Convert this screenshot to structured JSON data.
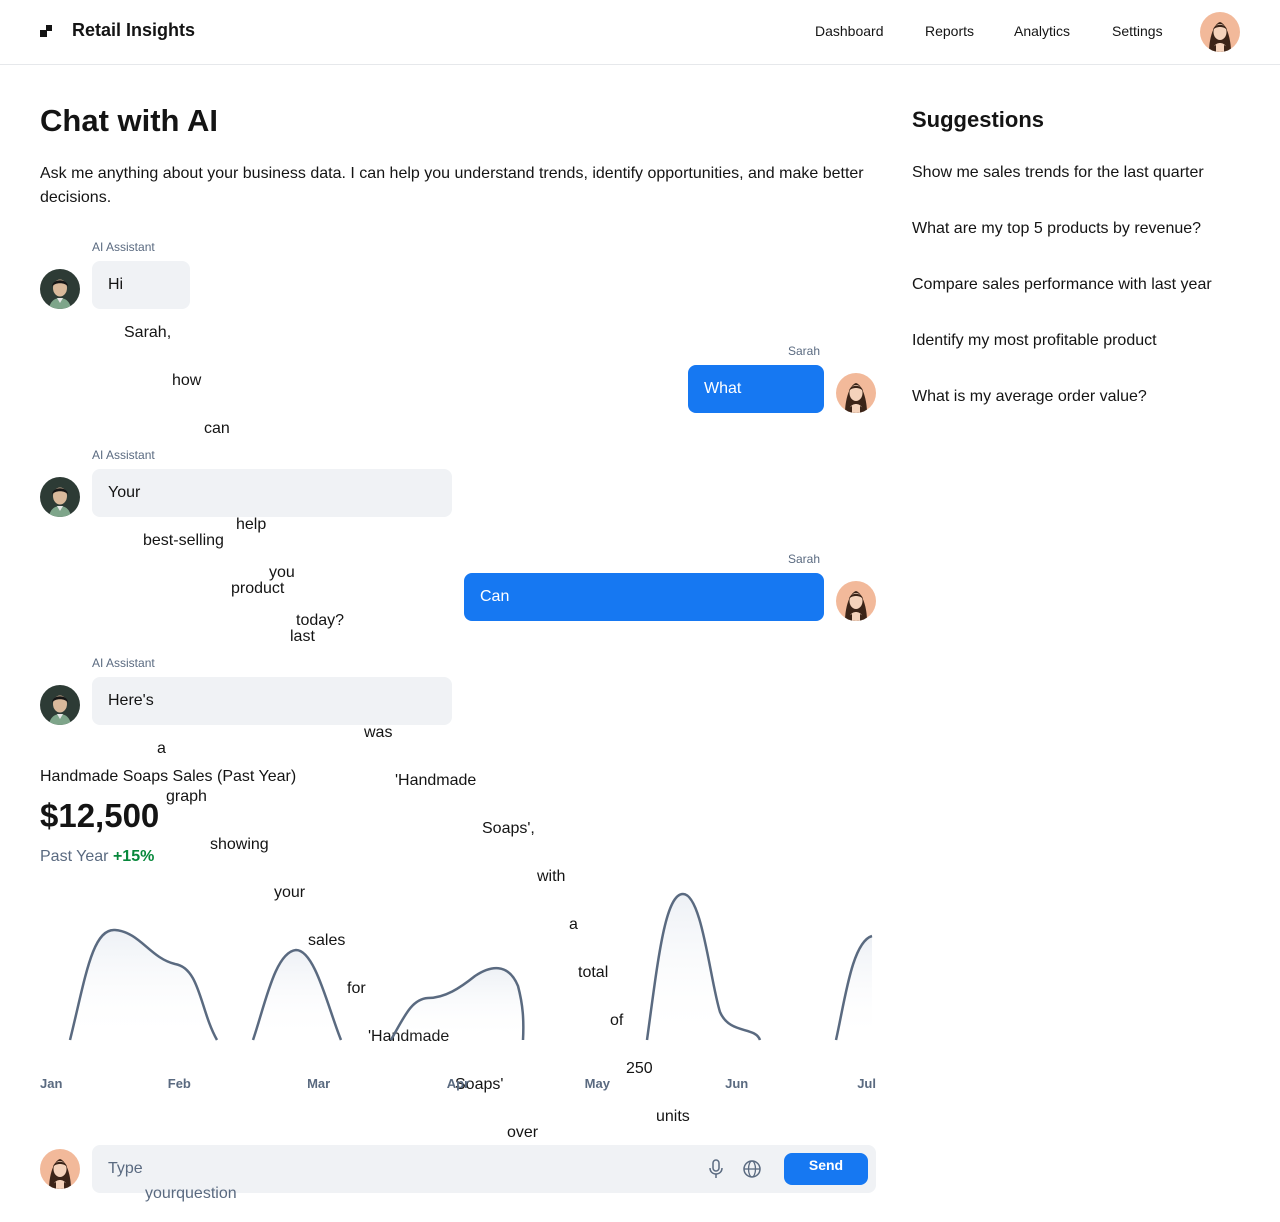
{
  "header": {
    "brand": "Retail Insights",
    "nav": [
      "Dashboard",
      "Reports",
      "Analytics",
      "Settings"
    ]
  },
  "main": {
    "title": "Chat with AI",
    "description": "Ask me anything about your business data. I can help you understand trends, identify opportunities, and make better decisions."
  },
  "messages": [
    {
      "role": "ai",
      "sender": "AI Assistant",
      "text": "Hi"
    },
    {
      "role": "user",
      "sender": "Sarah",
      "text": "What"
    },
    {
      "role": "ai",
      "sender": "AI Assistant",
      "text": "Your"
    },
    {
      "role": "user",
      "sender": "Sarah",
      "text": "Can"
    },
    {
      "role": "ai",
      "sender": "AI Assistant",
      "text": "Here's"
    }
  ],
  "overflow_words": {
    "greeting": [
      "Sarah,",
      "how",
      "can",
      "help",
      "you",
      "today?"
    ],
    "question": [
      "best-selling",
      "product",
      "last",
      "was",
      "'Handmade",
      "Soaps',",
      "with",
      "a",
      "total",
      "of",
      "250",
      "units",
      "over"
    ],
    "answer": [
      "a",
      "graph",
      "showing",
      "your",
      "sales",
      "for",
      "'Handmade",
      "Soaps'"
    ],
    "input": [
      "yourquestion"
    ]
  },
  "chart_data": {
    "type": "area",
    "title": "Handmade Soaps Sales (Past Year)",
    "value": "$12,500",
    "period": "Past Year",
    "change": "+15%",
    "categories": [
      "Jan",
      "Feb",
      "Mar",
      "Apr",
      "May",
      "Jun",
      "Jul"
    ],
    "line_color": "#5a6a80"
  },
  "suggestions": {
    "title": "Suggestions",
    "items": [
      "Show me sales trends for the last quarter",
      "What are my top 5 products by revenue?",
      "Compare sales performance with last year",
      "Identify my most profitable product",
      "What is my average order value?"
    ]
  },
  "input": {
    "placeholder": "Type",
    "send_label": "Send"
  }
}
